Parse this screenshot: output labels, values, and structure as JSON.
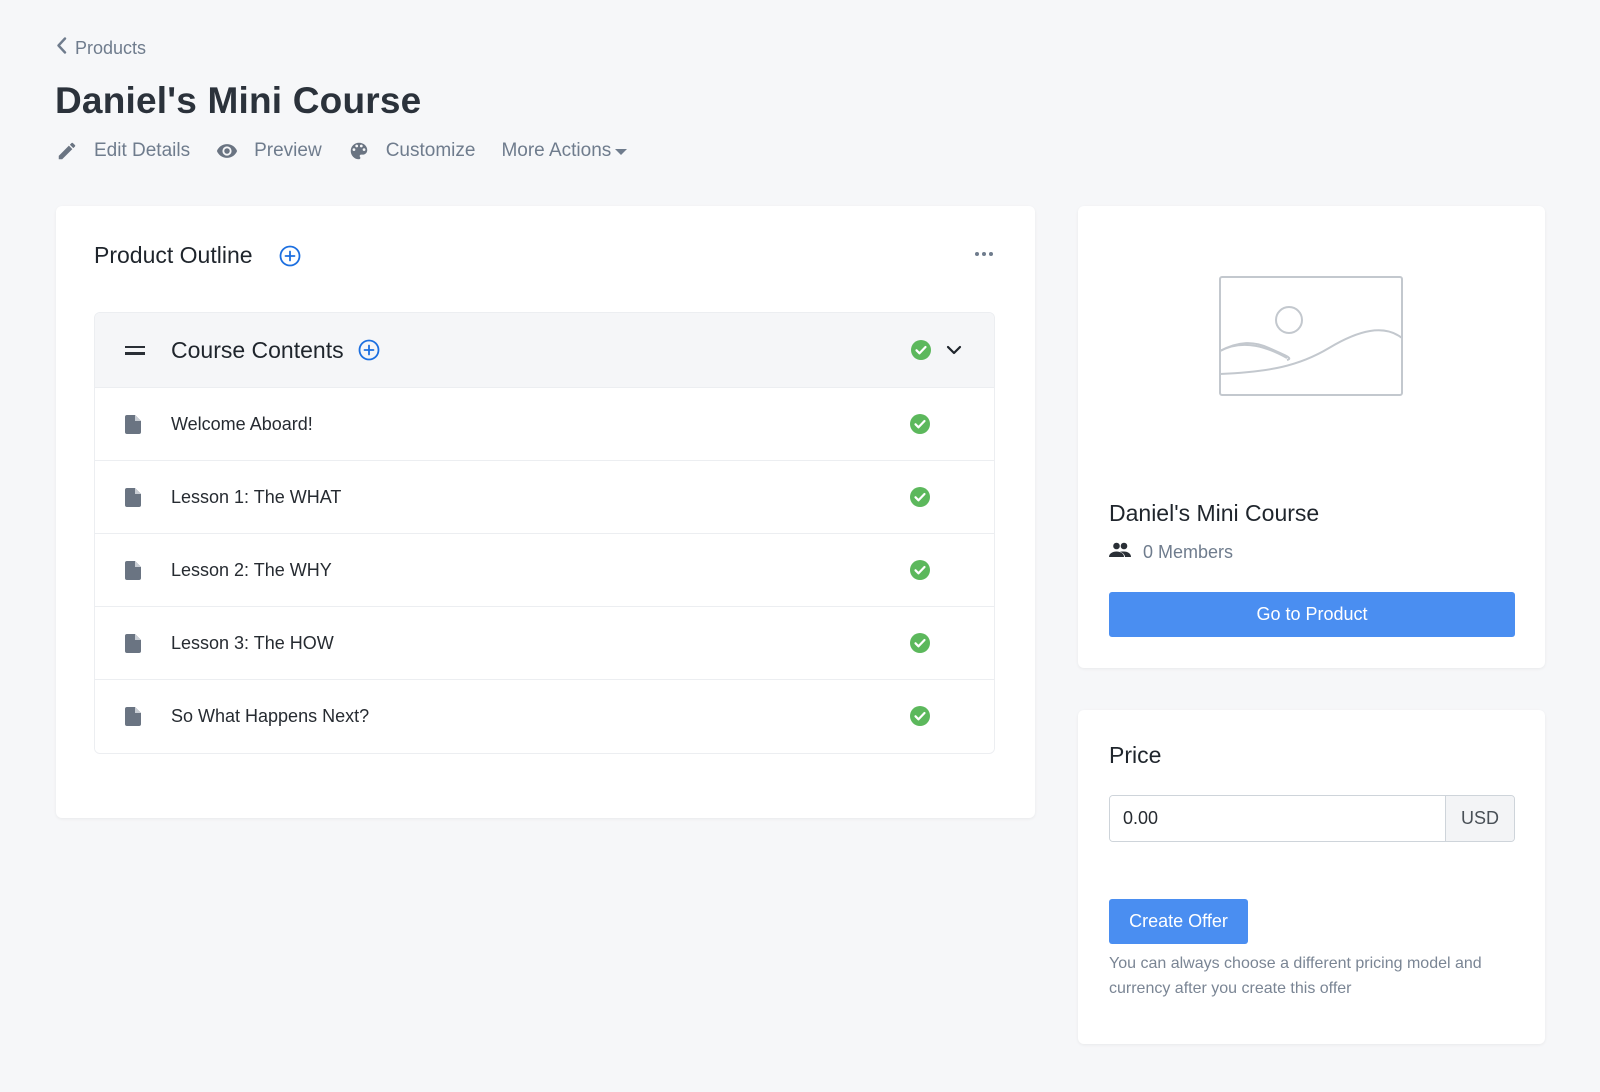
{
  "breadcrumb": {
    "label": "Products",
    "icon": "chevron-left-icon"
  },
  "page": {
    "title": "Daniel's Mini Course"
  },
  "actions": [
    {
      "label": "Edit Details",
      "icon": "pencil-icon"
    },
    {
      "label": "Preview",
      "icon": "eye-icon"
    },
    {
      "label": "Customize",
      "icon": "palette-icon"
    },
    {
      "label": "More Actions",
      "icon": "caret-down-icon"
    }
  ],
  "outline": {
    "title": "Product Outline",
    "add_icon": "plus-circle-icon",
    "menu_icon": "more-horizontal-icon",
    "chapter": {
      "title": "Course Contents",
      "status": "published",
      "expanded": true,
      "lessons": [
        {
          "title": "Welcome Aboard!",
          "status": "published"
        },
        {
          "title": "Lesson 1: The WHAT",
          "status": "published"
        },
        {
          "title": "Lesson 2: The WHY",
          "status": "published"
        },
        {
          "title": "Lesson 3: The HOW",
          "status": "published"
        },
        {
          "title": "So What Happens Next?",
          "status": "published"
        }
      ]
    }
  },
  "product": {
    "image": "image-placeholder-icon",
    "name": "Daniel's Mini Course",
    "members": "0 Members",
    "go_button": "Go to Product"
  },
  "price": {
    "label": "Price",
    "value": "0.00",
    "currency": "USD",
    "create_button": "Create Offer",
    "hint": "You can always choose a different pricing model and currency after you create this offer"
  },
  "colors": {
    "background": "#f6f7f9",
    "primary": "#4a8ef1",
    "accent_blue": "#1c6fe0",
    "success": "#5cb85c",
    "muted_text": "#6f7c8d"
  }
}
